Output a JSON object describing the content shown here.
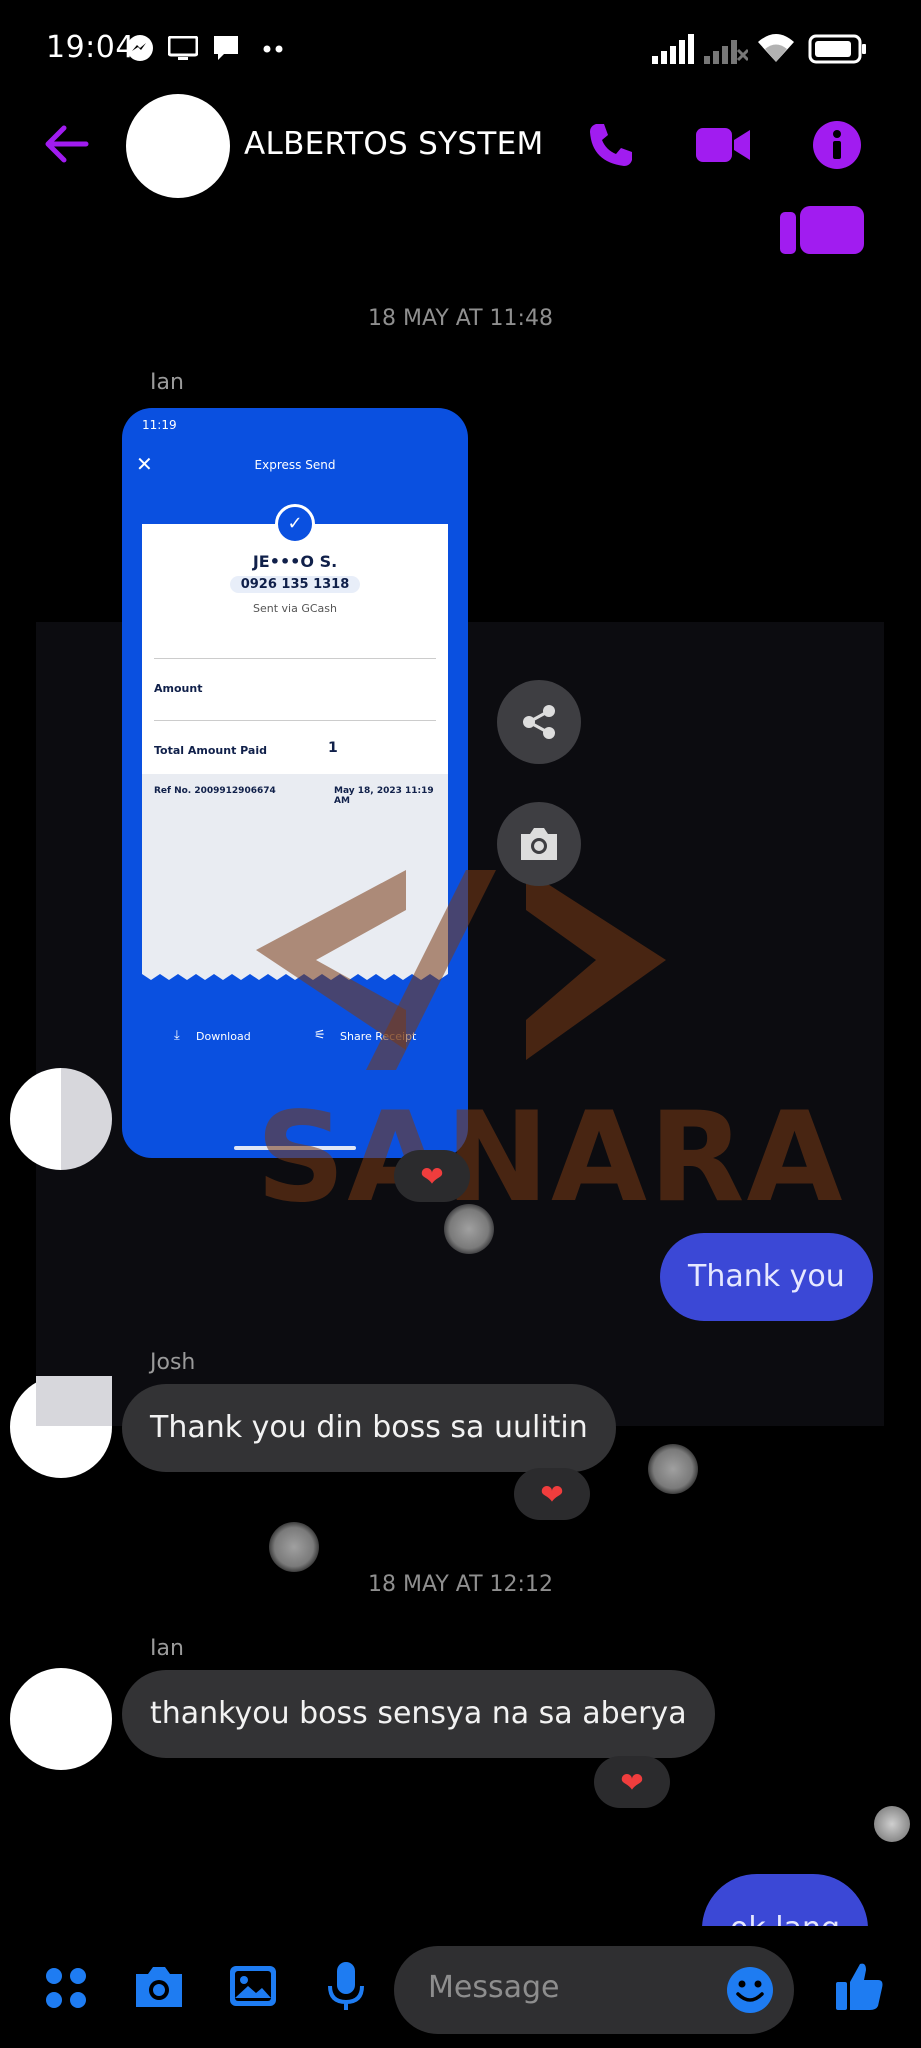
{
  "status_bar": {
    "time": "19:04"
  },
  "header": {
    "title": "ALBERTOS SYSTEM"
  },
  "conversation": {
    "date_1": "18 MAY AT 11:48",
    "sender_ian_1": "Ian",
    "receipt": {
      "time": "11:19",
      "title": "Express Send",
      "recipient_name": "JE•••O S.",
      "recipient_number": "0926 135 1318",
      "sent_via": "Sent via GCash",
      "amount_label": "Amount",
      "total_label": "Total Amount Paid",
      "total_value": "1",
      "ref_label": "Ref No. 2009912906674",
      "ref_date": "May 18, 2023 11:19 AM",
      "download_label": "Download",
      "share_label": "Share Receipt"
    },
    "watermark": "SANARA",
    "out_1": "Thank you",
    "sender_josh": "Josh",
    "josh_msg": "Thank you din boss sa uulitin",
    "date_2": "18 MAY AT 12:12",
    "sender_ian_2": "Ian",
    "ian_msg": "thankyou boss sensya na sa aberya",
    "out_2": "ok lang"
  },
  "composer": {
    "placeholder": "Message"
  },
  "colors": {
    "accent": "#a11cf0",
    "outgoing": "#3b48d6",
    "toolbar": "#1e7cf2"
  }
}
